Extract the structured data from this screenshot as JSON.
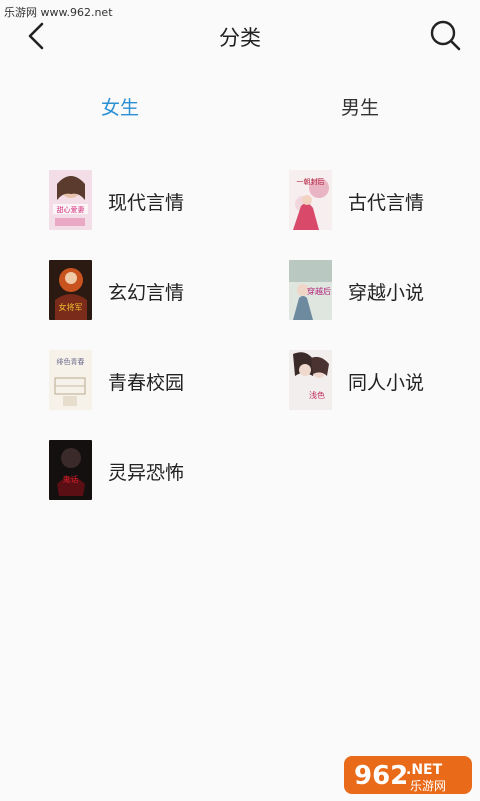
{
  "watermark": {
    "site": "乐游网 www.962.net",
    "logo_main": "962",
    "logo_suffix": ".NET",
    "logo_sub": "乐游网"
  },
  "header": {
    "title": "分类"
  },
  "tabs": [
    {
      "label": "女生",
      "active": true
    },
    {
      "label": "男生",
      "active": false
    }
  ],
  "categories": [
    {
      "label": "现代言情",
      "cover_text": "甜心爱妻"
    },
    {
      "label": "古代言情",
      "cover_text": "一朝封后"
    },
    {
      "label": "玄幻言情",
      "cover_text": "女将军"
    },
    {
      "label": "穿越小说",
      "cover_text": "穿越后"
    },
    {
      "label": "青春校园",
      "cover_text": "绯色青春"
    },
    {
      "label": "同人小说",
      "cover_text": "浅色"
    },
    {
      "label": "灵异恐怖",
      "cover_text": "鬼话"
    }
  ],
  "colors": {
    "accent": "#2a8fd3",
    "background": "#fafafa",
    "text": "#222222"
  }
}
